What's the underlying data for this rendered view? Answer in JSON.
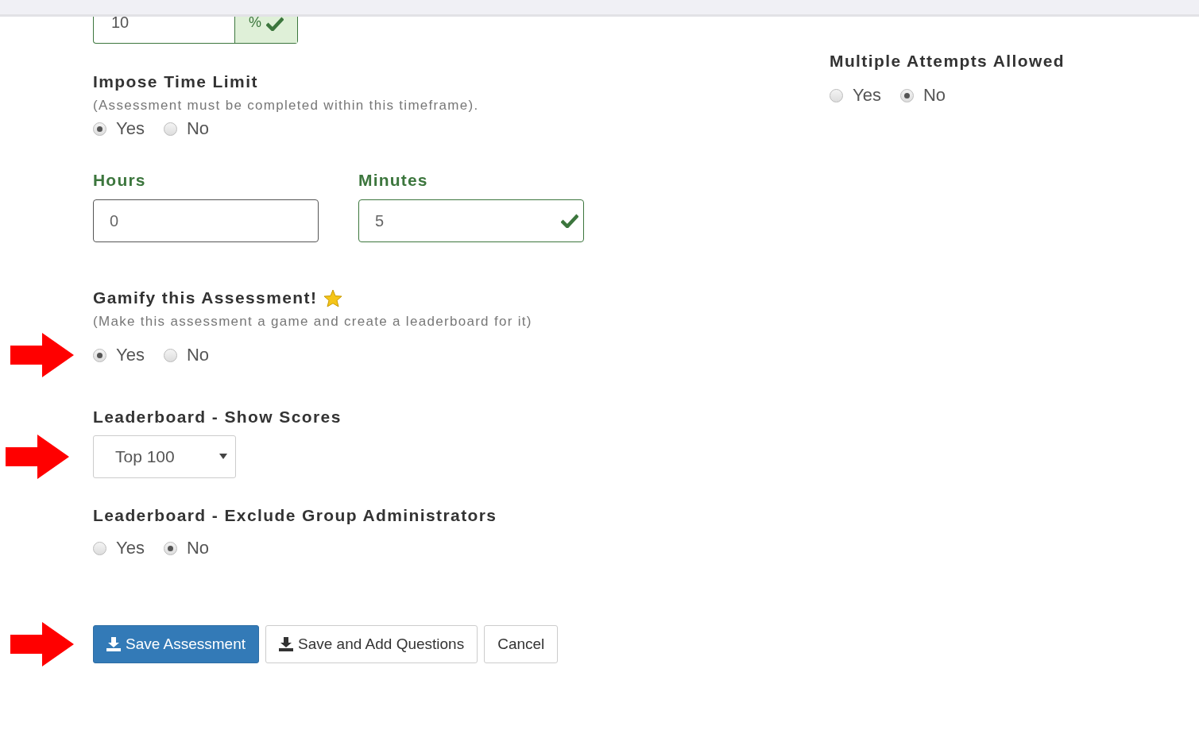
{
  "pass_field": {
    "value": "10",
    "addon": "%",
    "valid": true
  },
  "time_limit": {
    "title": "Impose Time Limit",
    "hint": "(Assessment must be completed within this timeframe).",
    "options": [
      {
        "label": "Yes",
        "selected": true
      },
      {
        "label": "No",
        "selected": false
      }
    ]
  },
  "duration": [
    {
      "label": "Hours",
      "value": "0",
      "valid": false
    },
    {
      "label": "Minutes",
      "value": "5",
      "valid": true
    }
  ],
  "gamify": {
    "title": "Gamify this Assessment!",
    "hint": "(Make this assessment a game and create a leaderboard for it)",
    "marked": true,
    "options": [
      {
        "label": "Yes",
        "selected": true
      },
      {
        "label": "No",
        "selected": false
      }
    ]
  },
  "show_scores": {
    "title": "Leaderboard - Show Scores",
    "value": "Top 100",
    "marked": true
  },
  "exclude_admins": {
    "title": "Leaderboard - Exclude Group Administrators",
    "options": [
      {
        "label": "Yes",
        "selected": false
      },
      {
        "label": "No",
        "selected": true
      }
    ]
  },
  "actions": {
    "marked": true,
    "buttons": [
      {
        "label": "Save Assessment",
        "kind": "primary"
      },
      {
        "label": "Save and Add Questions",
        "kind": "default"
      },
      {
        "label": "Cancel",
        "kind": "plain"
      }
    ]
  },
  "multiple_attempts": {
    "title": "Multiple Attempts Allowed",
    "options": [
      {
        "label": "Yes",
        "selected": false
      },
      {
        "label": "No",
        "selected": true
      }
    ]
  }
}
